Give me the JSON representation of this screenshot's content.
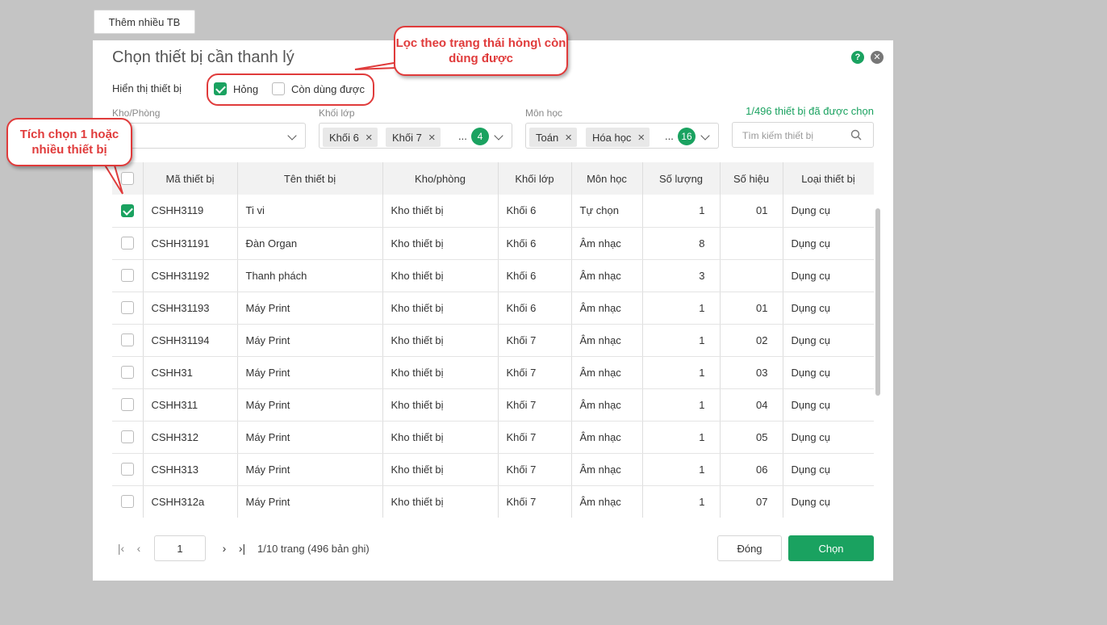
{
  "top_tab": {
    "label": "Thêm nhiều TB"
  },
  "dialog": {
    "title": "Chọn thiết bị cần thanh lý",
    "show_label": "Hiển thị thiết bị",
    "filter_options": [
      {
        "label": "Hỏng",
        "checked": true
      },
      {
        "label": "Còn dùng được",
        "checked": false
      }
    ],
    "fields": {
      "warehouse": {
        "label": "Kho/Phòng",
        "value": ""
      },
      "grade": {
        "label": "Khối lớp",
        "tags": [
          "Khối 6",
          "Khối 7"
        ],
        "more": "...",
        "count": "4"
      },
      "subject": {
        "label": "Môn học",
        "tags": [
          "Toán",
          "Hóa học"
        ],
        "more": "...",
        "count": "16"
      }
    },
    "selected_count": "1/496 thiết bị đã được chọn",
    "search": {
      "placeholder": "Tìm kiếm thiết bị"
    },
    "table": {
      "headers": [
        "Mã thiết bị",
        "Tên thiết bị",
        "Kho/phòng",
        "Khối lớp",
        "Môn học",
        "Số lượng",
        "Số hiệu",
        "Loại thiết bị"
      ],
      "rows": [
        {
          "checked": true,
          "code": "CSHH3119",
          "name": "Ti vi",
          "room": "Kho thiết bị",
          "grade": "Khối 6",
          "subject": "Tự chọn",
          "qty": "1",
          "serial": "01",
          "type": "Dụng cụ"
        },
        {
          "checked": false,
          "code": "CSHH31191",
          "name": "Đàn Organ",
          "room": "Kho thiết bị",
          "grade": "Khối 6",
          "subject": "Âm nhạc",
          "qty": "8",
          "serial": "",
          "type": "Dụng cụ"
        },
        {
          "checked": false,
          "code": "CSHH31192",
          "name": "Thanh phách",
          "room": "Kho thiết bị",
          "grade": "Khối 6",
          "subject": "Âm nhạc",
          "qty": "3",
          "serial": "",
          "type": "Dụng cụ"
        },
        {
          "checked": false,
          "code": "CSHH31193",
          "name": "Máy Print",
          "room": "Kho thiết bị",
          "grade": "Khối 6",
          "subject": "Âm nhạc",
          "qty": "1",
          "serial": "01",
          "type": "Dụng cụ"
        },
        {
          "checked": false,
          "code": "CSHH31194",
          "name": "Máy Print",
          "room": "Kho thiết bị",
          "grade": "Khối 7",
          "subject": "Âm nhạc",
          "qty": "1",
          "serial": "02",
          "type": "Dụng cụ"
        },
        {
          "checked": false,
          "code": "CSHH31",
          "name": "Máy Print",
          "room": "Kho thiết bị",
          "grade": "Khối 7",
          "subject": "Âm nhạc",
          "qty": "1",
          "serial": "03",
          "type": "Dụng cụ"
        },
        {
          "checked": false,
          "code": "CSHH311",
          "name": "Máy Print",
          "room": "Kho thiết bị",
          "grade": "Khối 7",
          "subject": "Âm nhạc",
          "qty": "1",
          "serial": "04",
          "type": "Dụng cụ"
        },
        {
          "checked": false,
          "code": "CSHH312",
          "name": "Máy Print",
          "room": "Kho thiết bị",
          "grade": "Khối 7",
          "subject": "Âm nhạc",
          "qty": "1",
          "serial": "05",
          "type": "Dụng cụ"
        },
        {
          "checked": false,
          "code": "CSHH313",
          "name": "Máy Print",
          "room": "Kho thiết bị",
          "grade": "Khối 7",
          "subject": "Âm nhạc",
          "qty": "1",
          "serial": "06",
          "type": "Dụng cụ"
        },
        {
          "checked": false,
          "code": "CSHH312a",
          "name": "Máy Print",
          "room": "Kho thiết bị",
          "grade": "Khối 7",
          "subject": "Âm nhạc",
          "qty": "1",
          "serial": "07",
          "type": "Dụng cụ"
        }
      ]
    },
    "pagination": {
      "current_page": "1",
      "info": "1/10 trang (496 bản ghi)"
    },
    "buttons": {
      "close": "Đóng",
      "select": "Chọn"
    }
  },
  "callouts": {
    "filter": "Lọc theo trạng thái hỏng\\ còn dùng được",
    "select": "Tích chọn 1 hoặc nhiều thiết bị"
  },
  "colors": {
    "accent": "#1aa260",
    "callout": "#e03b3b",
    "overlay": "#c4c4c4"
  }
}
